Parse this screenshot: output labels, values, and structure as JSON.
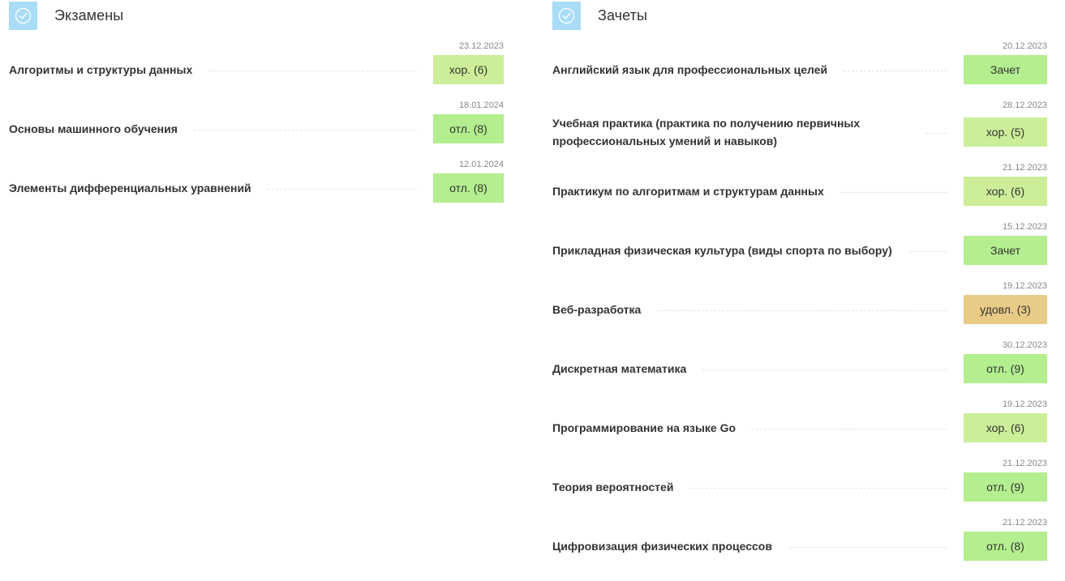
{
  "exams": {
    "title": "Экзамены",
    "icon": "check-circle-icon",
    "rows": [
      {
        "subject": "Алгоритмы и структуры данных",
        "date": "23.12.2023",
        "grade": "хор. (6)",
        "grade_color": "#ccee99"
      },
      {
        "subject": "Основы машинного обучения",
        "date": "18.01.2024",
        "grade": "отл. (8)",
        "grade_color": "#b3ee8f"
      },
      {
        "subject": "Элементы дифференциальных уравнений",
        "date": "12.01.2024",
        "grade": "отл. (8)",
        "grade_color": "#b3ee8f"
      }
    ]
  },
  "credits": {
    "title": "Зачеты",
    "icon": "check-circle-icon",
    "rows": [
      {
        "subject": "Английский язык для профессиональных целей",
        "date": "20.12.2023",
        "grade": "Зачет",
        "grade_color": "#b3ee8f"
      },
      {
        "subject": "Учебная практика (практика по получению первичных профессиональных умений и навыков)",
        "date": "28.12.2023",
        "grade": "хор. (5)",
        "grade_color": "#ccee99"
      },
      {
        "subject": "Практикум по алгоритмам и структурам данных",
        "date": "21.12.2023",
        "grade": "хор. (6)",
        "grade_color": "#ccee99"
      },
      {
        "subject": "Прикладная физическая культура (виды спорта по выбору)",
        "date": "15.12.2023",
        "grade": "Зачет",
        "grade_color": "#b3ee8f"
      },
      {
        "subject": "Веб-разработка",
        "date": "19.12.2023",
        "grade": "удовл. (3)",
        "grade_color": "#e8cb86"
      },
      {
        "subject": "Дискретная математика",
        "date": "30.12.2023",
        "grade": "отл. (9)",
        "grade_color": "#b3ee8f"
      },
      {
        "subject": "Программирование на языке Go",
        "date": "19.12.2023",
        "grade": "хор. (6)",
        "grade_color": "#ccee99"
      },
      {
        "subject": "Теория вероятностей",
        "date": "21.12.2023",
        "grade": "отл. (9)",
        "grade_color": "#b3ee8f"
      },
      {
        "subject": "Цифровизация физических процессов",
        "date": "21.12.2023",
        "grade": "отл. (8)",
        "grade_color": "#b3ee8f"
      }
    ]
  }
}
